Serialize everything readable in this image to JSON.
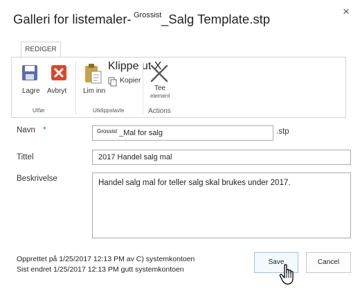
{
  "dialog": {
    "title_main": "Galleri for listemaler-",
    "title_tag": "Grossist",
    "title_suffix": "_Salg Template.stp",
    "close_glyph": "×"
  },
  "ribbon": {
    "tab_label": "REDIGER",
    "groups": [
      {
        "label": "Utfør",
        "buttons": [
          {
            "label": "Lagre",
            "icon": "save-icon"
          },
          {
            "label": "Avbryt",
            "icon": "cancel-icon"
          }
        ]
      },
      {
        "label": "Utklippstavle",
        "buttons": [
          {
            "label": "Lim inn",
            "icon": "paste-icon"
          },
          {
            "label": "Klippe ut X",
            "icon": "cut-icon"
          },
          {
            "label": "Kopier",
            "icon": "copy-icon"
          }
        ]
      },
      {
        "label": "Actions",
        "buttons": [
          {
            "label": "Tee",
            "sublabel": "element",
            "icon": "delete-item-icon"
          }
        ]
      }
    ]
  },
  "form": {
    "name_label": "Navn",
    "required_marker": "*",
    "name_prefix": "Grossist",
    "name_value": "_Mal for salg",
    "name_suffix": ".stp",
    "title_label": "Tittel",
    "title_value": "2017 Handel salg mal",
    "description_label": "Beskrivelse",
    "description_value": "Handel salg mal for teller salg skal brukes under 2017."
  },
  "footer": {
    "created": "Opprettet på 1/25/2017 12:13 PM av C) systemkontoen",
    "modified": "Sist endret 1/25/2017 12:13 PM gutt systemkontoen",
    "save_label": "Save",
    "cancel_label": "Cancel"
  },
  "colors": {
    "required": "#1e6fd1",
    "save_icon": "#5a6ea8",
    "cancel_icon": "#d9472b",
    "paste_icon": "#c8a24a"
  }
}
